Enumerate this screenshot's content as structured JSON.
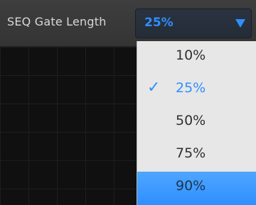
{
  "parameter": {
    "label": "SEQ Gate Length"
  },
  "select": {
    "value": "25%"
  },
  "dropdown": {
    "options": [
      {
        "label": "10%"
      },
      {
        "label": "25%",
        "checkmark": "✓"
      },
      {
        "label": "50%"
      },
      {
        "label": "75%"
      },
      {
        "label": "90%"
      }
    ]
  },
  "colors": {
    "accent": "#2f8fff",
    "menu_background": "#e7e7e7",
    "hover_background": "#3a98ff",
    "header_background": "#3a3a3a",
    "grid_background": "#101010"
  },
  "icons": {
    "dropdown_arrow": "triangle-down-icon",
    "selected_mark": "checkmark-icon"
  }
}
